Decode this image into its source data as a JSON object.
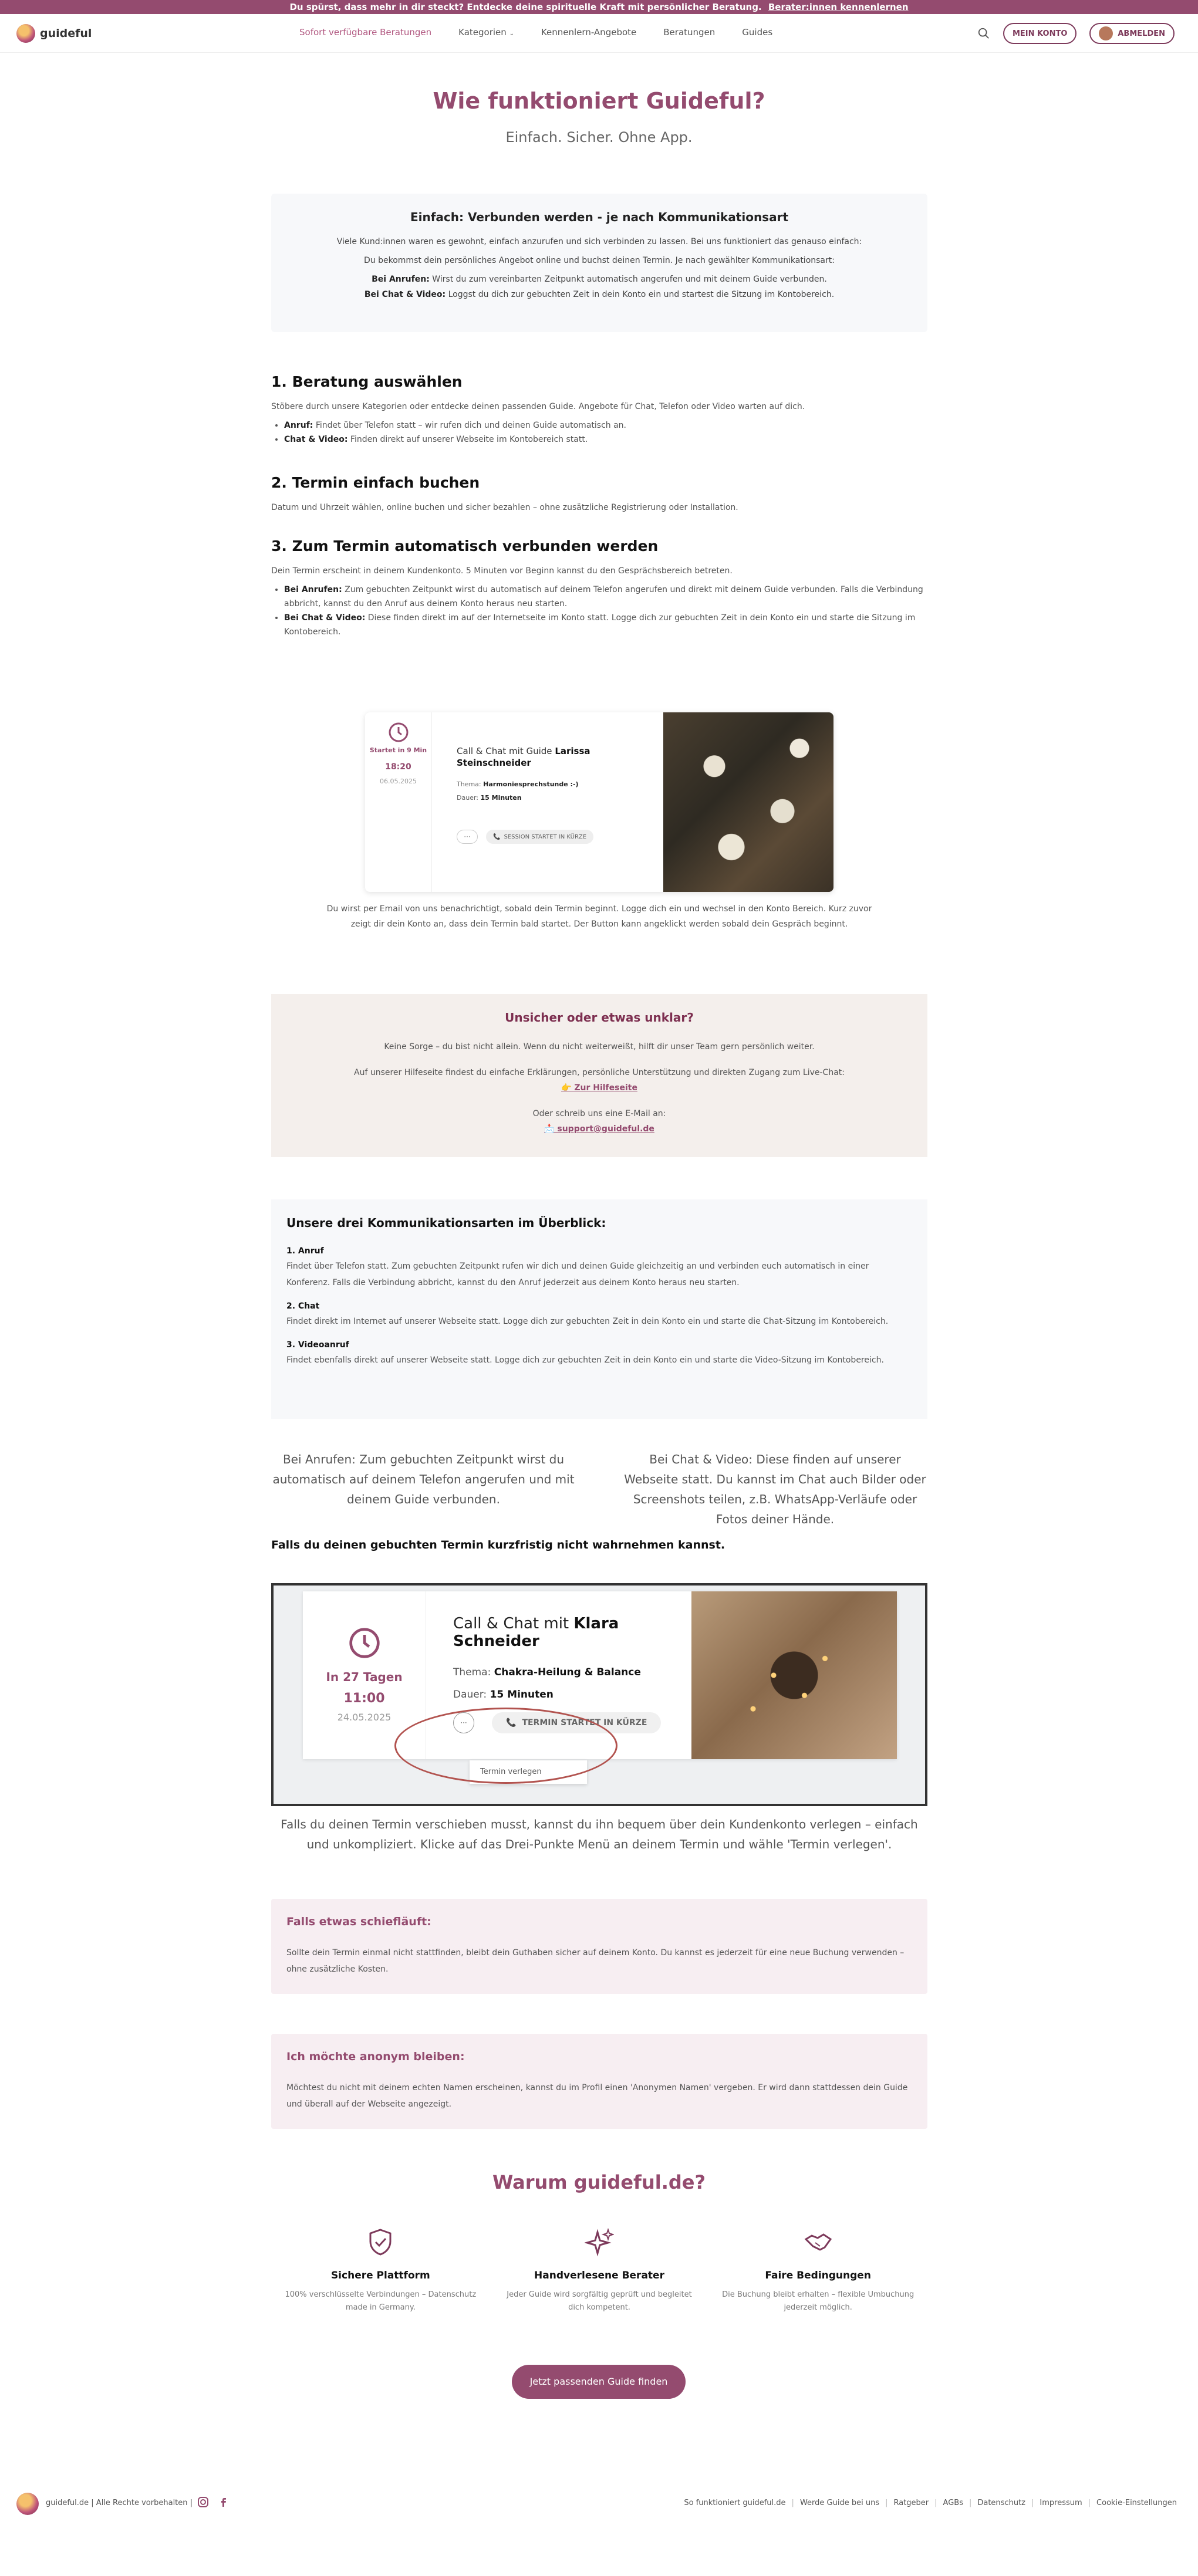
{
  "topbar": {
    "text": "Du spürst, dass mehr in dir steckt? Entdecke deine spirituelle Kraft mit persönlicher Beratung.",
    "link": "Berater:innen kennenlernen"
  },
  "nav": {
    "logo": "guideful",
    "links": [
      "Sofort verfügbare Beratungen",
      "Kategorien",
      "Kennenlern-Angebote",
      "Beratungen",
      "Guides"
    ],
    "account": "MEIN KONTO",
    "logout": "ABMELDEN"
  },
  "hero": {
    "title": "Wie funktioniert Guideful?",
    "subtitle": "Einfach. Sicher. Ohne App."
  },
  "intro": {
    "title": "Einfach: Verbunden werden - je nach Kommunikationsart",
    "p1": "Viele Kund:innen waren es gewohnt, einfach anzurufen und sich verbinden zu lassen. Bei uns funktioniert das genauso einfach:",
    "p2": "Du bekommst dein persönliches Angebot online und buchst deinen Termin. Je nach gewählter Kommunikationsart:",
    "call_label": "Bei Anrufen:",
    "call_text": "Wirst du zum vereinbarten Zeitpunkt automatisch angerufen und mit deinem Guide verbunden.",
    "chat_label": "Bei Chat & Video:",
    "chat_text": "Loggst du dich zur gebuchten Zeit in dein Konto ein und startest die Sitzung im Kontobereich."
  },
  "steps": [
    {
      "title": "1. Beratung auswählen",
      "text": "Stöbere durch unsere Kategorien oder entdecke deinen passenden Guide. Angebote für Chat, Telefon oder Video warten auf dich.",
      "items": [
        {
          "label": "Anruf:",
          "text": "Findet über Telefon statt – wir rufen dich und deinen Guide automatisch an."
        },
        {
          "label": "Chat & Video:",
          "text": "Finden direkt auf unserer Webseite im Kontobereich statt."
        }
      ]
    },
    {
      "title": "2. Termin einfach buchen",
      "text": "Datum und Uhrzeit wählen, online buchen und sicher bezahlen – ohne zusätzliche Registrierung oder Installation."
    },
    {
      "title": "3. Zum Termin automatisch verbunden werden",
      "text": "Dein Termin erscheint in deinem Kundenkonto. 5 Minuten vor Beginn kannst du den Gesprächsbereich betreten.",
      "items": [
        {
          "label": "Bei Anrufen:",
          "text": "Zum gebuchten Zeitpunkt wirst du automatisch auf deinem Telefon angerufen und direkt mit deinem Guide verbunden. Falls die Verbindung abbricht, kannst du den Anruf aus deinem Konto heraus neu starten."
        },
        {
          "label": "Bei Chat & Video:",
          "text": "Diese finden direkt im auf der Internetseite im Konto statt. Logge dich zur gebuchten Zeit in dein Konto ein und starte die Sitzung im Kontobereich."
        }
      ]
    }
  ],
  "card1": {
    "starts": "Startet in 9 Min",
    "time": "18:20",
    "date": "06.05.2025",
    "title_prefix": "Call & Chat mit Guide",
    "guide": "Larissa Steinschneider",
    "topic_label": "Thema:",
    "topic": "Harmoniesprechstunde :-)",
    "duration_label": "Dauer:",
    "duration": "15 Minuten",
    "dots": "···",
    "button": "SESSION STARTET IN KÜRZE"
  },
  "caption1": "Du wirst per Email von uns benachrichtigt, sobald dein Termin beginnt. Logge dich ein und wechsel in den Konto Bereich. Kurz zuvor zeigt dir dein Konto an, dass dein Termin bald startet. Der Button kann angeklickt werden sobald dein Gespräch beginnt.",
  "help": {
    "title": "Unsicher oder etwas unklar?",
    "p1": "Keine Sorge – du bist nicht allein. Wenn du nicht weiterweißt, hilft dir unser Team gern persönlich weiter.",
    "p2": "Auf unserer Hilfeseite findest du einfache Erklärungen, persönliche Unterstützung und direkten Zugang zum Live-Chat:",
    "link1": "👉 Zur Hilfeseite",
    "p3": "Oder schreib uns eine E-Mail an:",
    "link2": "📩 support@guideful.de"
  },
  "kom": {
    "title": "Unsere drei Kommunikationsarten im Überblick:",
    "items": [
      {
        "title": "1. Anruf",
        "text": "Findet über Telefon statt. Zum gebuchten Zeitpunkt rufen wir dich und deinen Guide gleichzeitig an und verbinden euch automatisch in einer Konferenz. Falls die Verbindung abbricht, kannst du den Anruf jederzeit aus deinem Konto heraus neu starten."
      },
      {
        "title": "2. Chat",
        "text": "Findet direkt im Internet auf unserer Webseite statt. Logge dich zur gebuchten Zeit in dein Konto ein und starte die Chat-Sitzung im Kontobereich."
      },
      {
        "title": "3. Videoanruf",
        "text": "Findet ebenfalls direkt auf unserer Webseite statt. Logge dich zur gebuchten Zeit in dein Konto ein und starte die Video-Sitzung im Kontobereich."
      }
    ]
  },
  "twocol": {
    "left": "Bei Anrufen: Zum gebuchten Zeitpunkt wirst du automatisch auf deinem Telefon angerufen und mit deinem Guide verbunden.",
    "right": "Bei Chat & Video: Diese finden auf unserer Webseite statt. Du kannst im Chat auch Bilder oder Screenshots teilen, z.B. WhatsApp-Verläufe oder Fotos deiner Hände."
  },
  "miss_title": "Falls du deinen gebuchten Termin kurzfristig nicht wahrnehmen kannst.",
  "card2": {
    "in": "In 27 Tagen",
    "time": "11:00",
    "date": "24.05.2025",
    "title_prefix": "Call & Chat mit",
    "guide": "Klara Schneider",
    "topic_label": "Thema:",
    "topic": "Chakra-Heilung & Balance",
    "duration_label": "Dauer:",
    "duration": "15 Minuten",
    "dots": "···",
    "button": "TERMIN STARTET IN KÜRZE",
    "menu_item": "Termin verlegen"
  },
  "caption2": "Falls du deinen Termin verschieben musst, kannst du ihn bequem über dein Kundenkonto verlegen – einfach und unkompliziert. Klicke auf das Drei-Punkte Menü an deinem Termin und wähle 'Termin verlegen'.",
  "box_fail": {
    "title": "Falls etwas schiefläuft:",
    "text": "Sollte dein Termin einmal nicht stattfinden, bleibt dein Guthaben sicher auf deinem Konto. Du kannst es jederzeit für eine neue Buchung verwenden – ohne zusätzliche Kosten."
  },
  "box_anon": {
    "title": "Ich möchte anonym bleiben:",
    "text": "Möchtest du nicht mit deinem echten Namen erscheinen, kannst du im Profil einen 'Anonymen Namen' vergeben. Er wird dann stattdessen dein Guide und überall auf der Webseite angezeigt."
  },
  "warum": {
    "title": "Warum guideful.de?",
    "features": [
      {
        "icon": "shield-check-icon",
        "title": "Sichere Plattform",
        "text": "100% verschlüsselte Verbindungen – Datenschutz made in Germany."
      },
      {
        "icon": "sparkles-icon",
        "title": "Handverlesene Berater",
        "text": "Jeder Guide wird sorgfältig geprüft und begleitet dich kompetent."
      },
      {
        "icon": "handshake-icon",
        "title": "Faire Bedingungen",
        "text": "Die Buchung bleibt erhalten – flexible Umbuchung jederzeit möglich."
      }
    ],
    "cta": "Jetzt passenden Guide finden"
  },
  "footer": {
    "copyright": "guideful.de | Alle Rechte vorbehalten |",
    "links": [
      "So funktioniert guideful.de",
      "Werde Guide bei uns",
      "Ratgeber",
      "AGBs",
      "Datenschutz",
      "Impressum",
      "Cookie-Einstellungen"
    ]
  },
  "colors": {
    "brand": "#944b6f",
    "bg_soft": "#f7f8fa",
    "pink_soft": "#f7eef2",
    "beige_soft": "#f4efec"
  }
}
